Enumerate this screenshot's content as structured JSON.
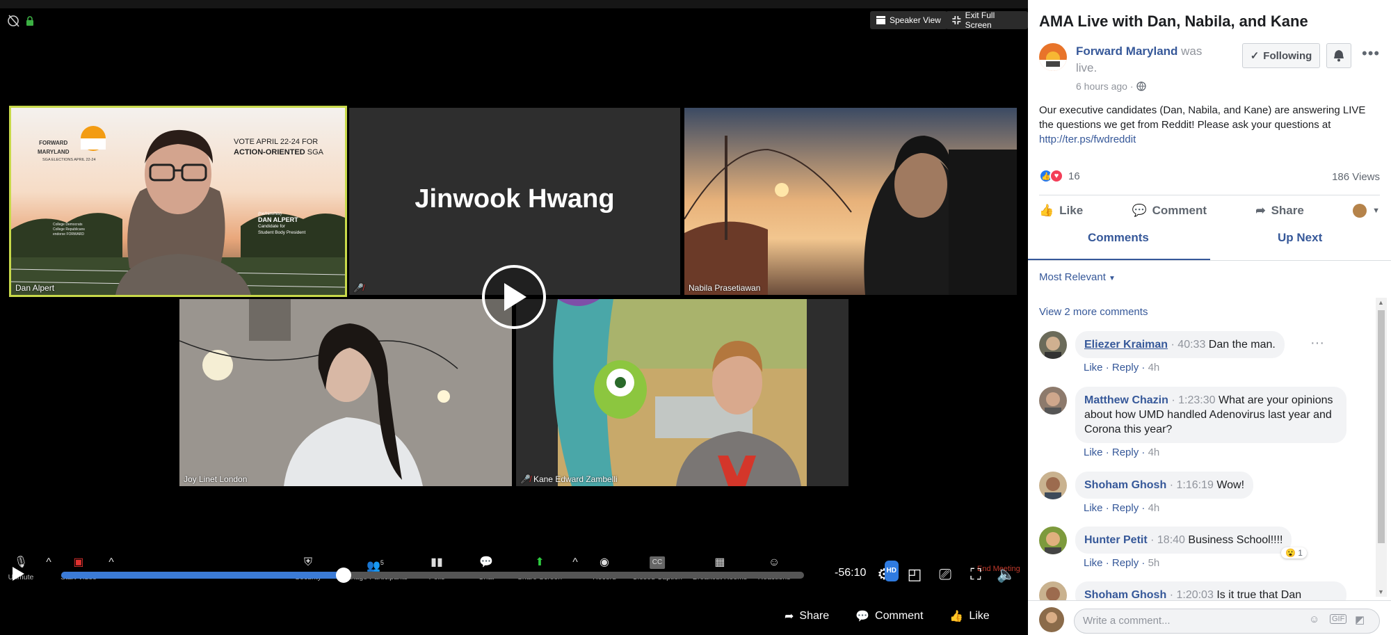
{
  "zoom": {
    "top_buttons": {
      "speaker_view": "Speaker View",
      "exit_full_screen": "Exit Full Screen"
    },
    "participants": [
      {
        "name": "Dan Alpert",
        "muted": false,
        "active_speaker": true
      },
      {
        "name": "Jinwook Hwang",
        "muted": true,
        "video_on": false
      },
      {
        "name": "Nabila Prasetiawan",
        "muted": false
      },
      {
        "name": "Joy Linet London",
        "muted": false
      },
      {
        "name": "Kane Edward Zambelli",
        "muted": true
      }
    ],
    "dan_background": {
      "brand_top": "FORWARD",
      "brand_bottom": "MARYLAND",
      "tagline": "SGA ELECTIONS APRIL 22-24",
      "vote_line1": "VOTE APRIL 22-24 FOR",
      "vote_line2_bold": "ACTION-ORIENTED",
      "vote_line2_rest": " SGA",
      "pronouns": "(he/him/his)",
      "candidate_name": "DAN ALPERT",
      "candidate_role_1": "Candidate for",
      "candidate_role_2": "Student Body President",
      "endorse_1": "College Democrats",
      "endorse_2": "College Republicans",
      "endorse_3": "endorse FORWARD"
    },
    "toolbar": {
      "unmute": "Unmute",
      "start_video": "Start Video",
      "security": "Security",
      "manage_participants": "Manage Participants",
      "participant_count": "5",
      "polls": "Polls",
      "chat": "Chat",
      "share_screen": "Share Screen",
      "record": "Record",
      "closed_caption": "Closed Caption",
      "cc_label": "CC",
      "breakout_rooms": "Breakout Rooms",
      "reactions": "Reactions",
      "end_meeting": "End Meeting"
    },
    "player": {
      "time_remaining": "-56:10",
      "progress_fraction": 0.38,
      "hd_badge": "HD"
    },
    "bottom_actions": {
      "share": "Share",
      "comment": "Comment",
      "like": "Like"
    }
  },
  "facebook": {
    "title": "AMA Live with Dan, Nabila, and Kane",
    "page_name": "Forward Maryland",
    "page_suffix": " was live.",
    "time_ago": "6 hours ago · ",
    "follow_label": "Following",
    "description": "Our executive candidates (Dan, Nabila, and Kane) are answering LIVE the questions we get from Reddit! Please ask your questions at",
    "description_link": "http://ter.ps/fwdreddit",
    "reaction_count": "16",
    "views": "186 Views",
    "actions": {
      "like": "Like",
      "comment": "Comment",
      "share": "Share"
    },
    "tabs": {
      "comments": "Comments",
      "up_next": "Up Next"
    },
    "sort": "Most Relevant",
    "view_more": "View 2 more comments",
    "comments": [
      {
        "author": "Eliezer Kraiman",
        "ts": "40:33",
        "text": "Dan the man.",
        "like": "Like",
        "reply": "Reply",
        "age": "4h"
      },
      {
        "author": "Matthew Chazin",
        "ts": "1:23:30",
        "text_line1": "What are your",
        "text_line2": "opinions about how UMD handled Adenovirus",
        "text_line3": "last year and Corona this year?",
        "like": "Like",
        "reply": "Reply",
        "age": "4h"
      },
      {
        "author": "Shoham Ghosh",
        "ts": "1:16:19",
        "text": "Wow!",
        "like": "Like",
        "reply": "Reply",
        "age": "4h"
      },
      {
        "author": "Hunter Petit",
        "ts": "18:40",
        "text": "Business School!!!!",
        "like": "Like",
        "reply": "Reply",
        "age": "5h",
        "reaction_count": "1"
      },
      {
        "author": "Shoham Ghosh",
        "ts": "1:20:03",
        "text": "Is it true that Dan"
      }
    ],
    "composer_placeholder": "Write a comment...",
    "composer_gif": "GIF"
  }
}
